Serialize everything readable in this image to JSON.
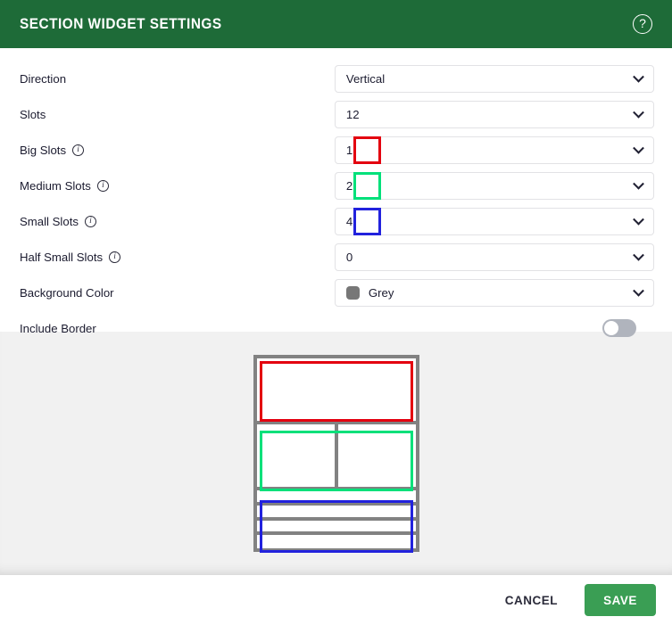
{
  "header": {
    "title": "SECTION WIDGET SETTINGS",
    "help_icon": "help-circle-icon",
    "background_color": "#1e6b38"
  },
  "form": {
    "fields": [
      {
        "label": "Direction",
        "value": "Vertical",
        "has_info": false,
        "type": "select"
      },
      {
        "label": "Slots",
        "value": "12",
        "has_info": false,
        "type": "select"
      },
      {
        "label": "Big Slots",
        "value": "1",
        "has_info": true,
        "type": "select",
        "highlight": "#e3000f"
      },
      {
        "label": "Medium Slots",
        "value": "2",
        "has_info": true,
        "type": "select",
        "highlight": "#00e07a"
      },
      {
        "label": "Small Slots",
        "value": "4",
        "has_info": true,
        "type": "select",
        "highlight": "#2222dd"
      },
      {
        "label": "Half Small Slots",
        "value": "0",
        "has_info": true,
        "type": "select"
      },
      {
        "label": "Background Color",
        "value": "Grey",
        "has_info": false,
        "type": "color-select",
        "swatch_color": "#777777"
      },
      {
        "label": "Include Border",
        "value": "off",
        "has_info": false,
        "type": "toggle"
      }
    ],
    "info_glyph": "i"
  },
  "preview": {
    "big_slot_outline": "#e3000f",
    "medium_slot_outline": "#00e07a",
    "small_slot_outline": "#2222dd",
    "grid_line_color": "#828282",
    "big_slot_count": 1,
    "medium_slot_count": 2,
    "small_slot_count": 4,
    "background": "#f1f1f1"
  },
  "footer": {
    "cancel_label": "CANCEL",
    "save_label": "SAVE",
    "save_color": "#3a9e54"
  }
}
